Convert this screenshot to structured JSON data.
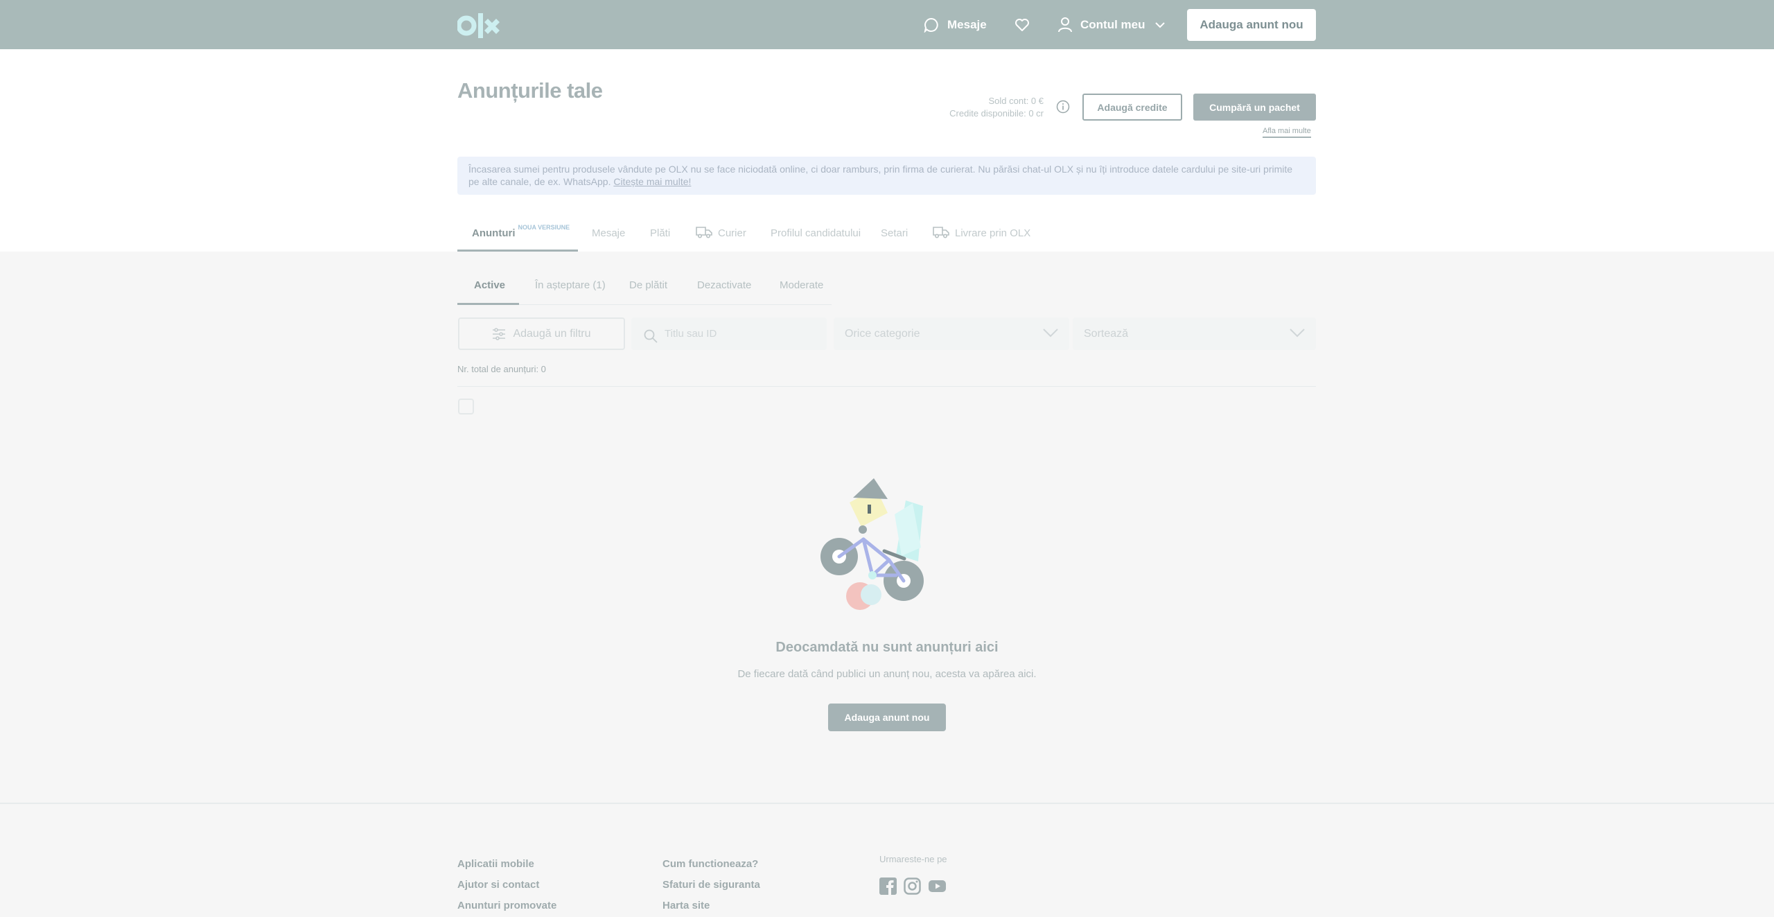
{
  "header": {
    "messages_label": "Mesaje",
    "account_label": "Contul meu",
    "post_button": "Adauga anunt nou",
    "colors": {
      "bar": "#a9bab9",
      "logo": "#cdeff0"
    }
  },
  "page": {
    "title": "Anunțurile tale",
    "balance": "Sold cont: 0 €",
    "credits": "Credite disponibile: 0 cr",
    "add_credits_button": "Adaugă credite",
    "buy_package_button": "Cumpără un pachet",
    "learn_more_link": "Afla mai multe",
    "notice_text": "Încasarea sumei pentru produsele vândute pe OLX nu se face niciodată online, ci doar ramburs, prin firma de curierat. Nu părăsi chat-ul OLX și nu îți introduce datele cardului pe site-uri primite pe alte canale, de ex. WhatsApp.",
    "notice_link": "Citește mai multe!"
  },
  "main_tabs": [
    {
      "label": "Anunturi",
      "badge": "NOUA VERSIUNE",
      "active": true
    },
    {
      "label": "Mesaje"
    },
    {
      "label": "Plăti"
    },
    {
      "label": "Curier",
      "icon": "truck-icon"
    },
    {
      "label": "Profilul candidatului"
    },
    {
      "label": "Setari"
    },
    {
      "label": "Livrare prin OLX",
      "icon": "truck-icon"
    }
  ],
  "sub_tabs": [
    {
      "label": "Active",
      "active": true
    },
    {
      "label": "În așteptare (1)"
    },
    {
      "label": "De plătit"
    },
    {
      "label": "Dezactivate"
    },
    {
      "label": "Moderate"
    }
  ],
  "filters": {
    "add_filter_button": "Adaugă un filtru",
    "search_placeholder": "Titlu sau ID",
    "category_select": "Orice categorie",
    "sort_select": "Sortează"
  },
  "list": {
    "total_label": "Nr. total de anunțuri: 0"
  },
  "empty_state": {
    "title": "Deocamdată nu sunt anunțuri aici",
    "subtitle": "De fiecare dată când publici un anunț nou, acesta va apărea aici.",
    "button": "Adauga anunt nou"
  },
  "footer": {
    "col1": [
      "Aplicatii mobile",
      "Ajutor si contact",
      "Anunturi promovate"
    ],
    "col2": [
      "Cum functioneaza?",
      "Sfaturi de siguranta",
      "Harta site"
    ],
    "follow_label": "Urmareste-ne pe",
    "social": [
      "facebook-icon",
      "instagram-icon",
      "youtube-icon"
    ]
  }
}
